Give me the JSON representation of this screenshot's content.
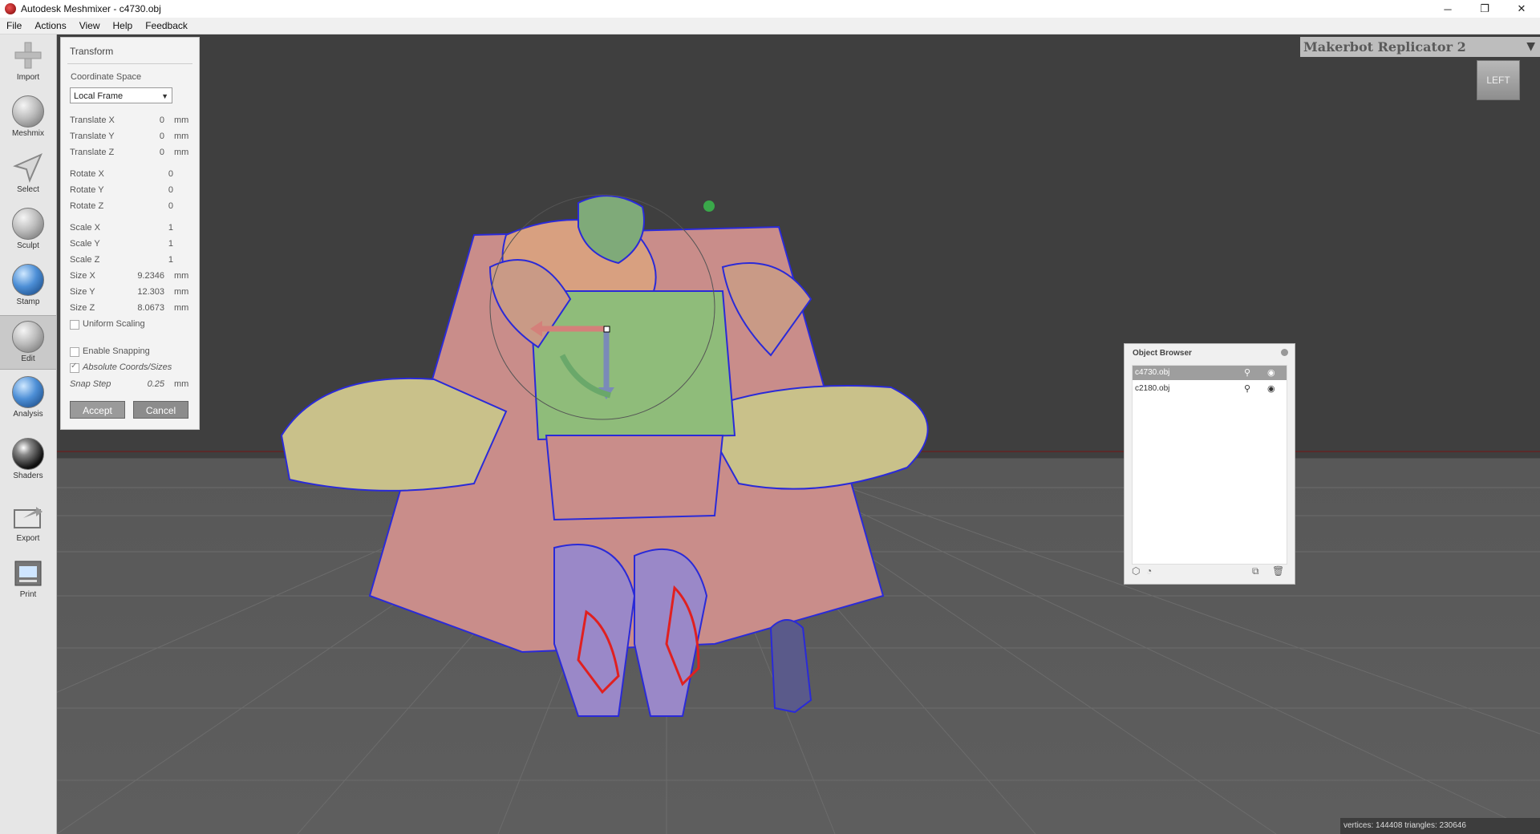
{
  "window": {
    "title": "Autodesk Meshmixer - c4730.obj",
    "controls": [
      "─",
      "❐",
      "✕"
    ]
  },
  "menu": [
    "File",
    "Actions",
    "View",
    "Help",
    "Feedback"
  ],
  "toolbar": [
    {
      "label": "Import",
      "icon": "plus-icon"
    },
    {
      "label": "Meshmix",
      "icon": "head-sphere-icon"
    },
    {
      "label": "Select",
      "icon": "arrow-cursor-icon"
    },
    {
      "label": "Sculpt",
      "icon": "brush-sphere-icon"
    },
    {
      "label": "Stamp",
      "icon": "stamp-sphere-icon"
    },
    {
      "label": "Edit",
      "icon": "wire-sphere-icon",
      "active": true
    },
    {
      "label": "Analysis",
      "icon": "mesh-sphere-icon"
    },
    {
      "label": "Shaders",
      "icon": "black-sphere-icon"
    },
    {
      "label": "Export",
      "icon": "export-folder-icon"
    },
    {
      "label": "Print",
      "icon": "printer-icon"
    }
  ],
  "transform": {
    "title": "Transform",
    "coord_label": "Coordinate Space",
    "coord_value": "Local Frame",
    "rows": [
      {
        "label": "Translate X",
        "value": "0",
        "unit": "mm"
      },
      {
        "label": "Translate Y",
        "value": "0",
        "unit": "mm"
      },
      {
        "label": "Translate Z",
        "value": "0",
        "unit": "mm"
      },
      {
        "label": "Rotate X",
        "value": "0",
        "unit": ""
      },
      {
        "label": "Rotate Y",
        "value": "0",
        "unit": ""
      },
      {
        "label": "Rotate Z",
        "value": "0",
        "unit": ""
      },
      {
        "label": "Scale X",
        "value": "1",
        "unit": ""
      },
      {
        "label": "Scale Y",
        "value": "1",
        "unit": ""
      },
      {
        "label": "Scale Z",
        "value": "1",
        "unit": ""
      },
      {
        "label": "Size X",
        "value": "9.2346",
        "unit": "mm"
      },
      {
        "label": "Size Y",
        "value": "12.303",
        "unit": "mm"
      },
      {
        "label": "Size Z",
        "value": "8.0673",
        "unit": "mm"
      }
    ],
    "uniform_scaling": "Uniform Scaling",
    "enable_snapping": "Enable Snapping",
    "absolute_coords": "Absolute Coords/Sizes",
    "snap_step_label": "Snap Step",
    "snap_step_value": "0.25",
    "snap_step_unit": "mm",
    "accept": "Accept",
    "cancel": "Cancel"
  },
  "printer": {
    "name": "Makerbot Replicator 2",
    "dropdown": "▼"
  },
  "viewcube": {
    "label": "LEFT"
  },
  "object_browser": {
    "title": "Object Browser",
    "items": [
      {
        "name": "c4730.obj",
        "selected": true
      },
      {
        "name": "c2180.obj",
        "selected": false
      }
    ]
  },
  "status": "vertices: 144408 triangles: 230646"
}
